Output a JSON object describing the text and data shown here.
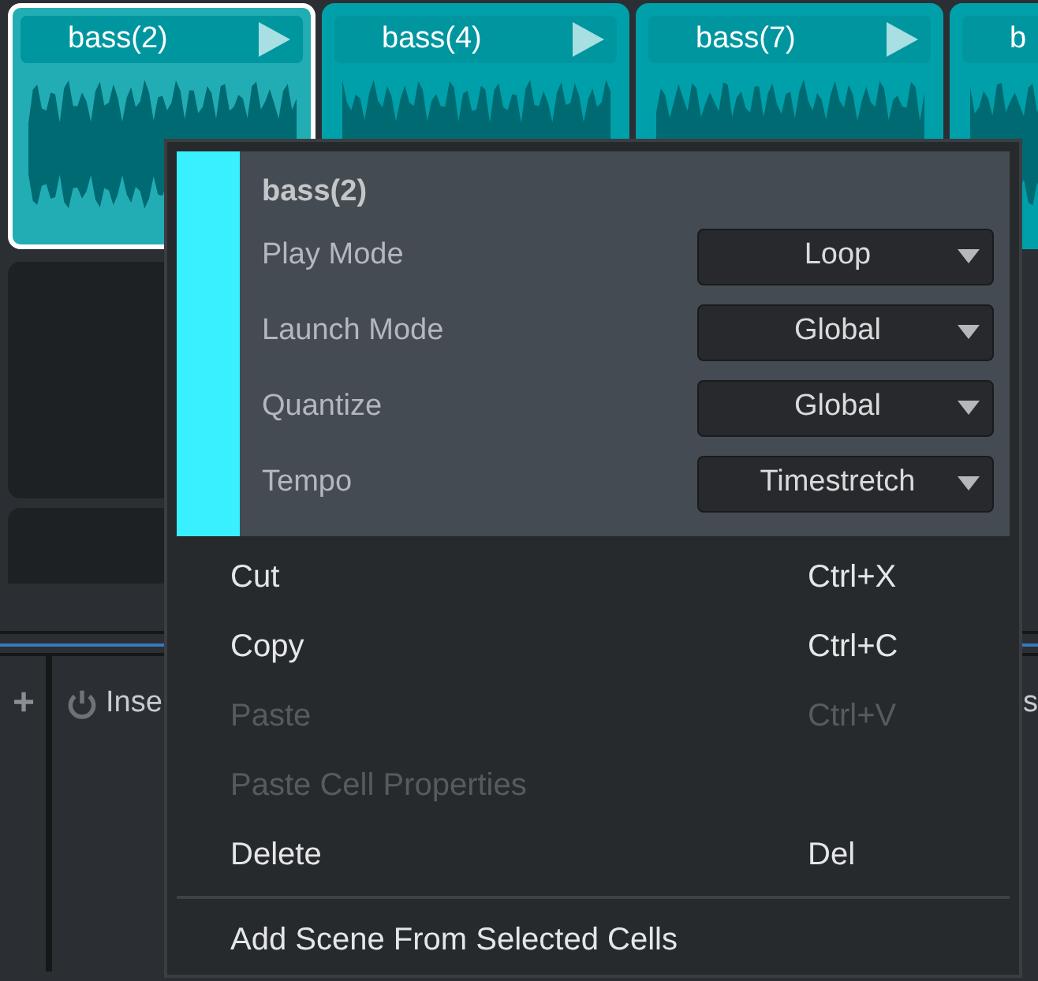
{
  "clips": [
    {
      "label": "bass(2)",
      "selected": true
    },
    {
      "label": "bass(4)",
      "selected": false
    },
    {
      "label": "bass(7)",
      "selected": false
    },
    {
      "label": "b",
      "selected": false
    }
  ],
  "mixer": {
    "add_icon": "+",
    "insert_label": "Inse",
    "right_label": "s"
  },
  "context_menu": {
    "header": {
      "title": "bass(2)",
      "color": "#38f0ff",
      "properties": [
        {
          "label": "Play Mode",
          "value": "Loop"
        },
        {
          "label": "Launch Mode",
          "value": "Global"
        },
        {
          "label": "Quantize",
          "value": "Global"
        },
        {
          "label": "Tempo",
          "value": "Timestretch"
        }
      ]
    },
    "items": [
      {
        "kind": "item",
        "label": "Cut",
        "shortcut": "Ctrl+X",
        "disabled": false
      },
      {
        "kind": "item",
        "label": "Copy",
        "shortcut": "Ctrl+C",
        "disabled": false
      },
      {
        "kind": "item",
        "label": "Paste",
        "shortcut": "Ctrl+V",
        "disabled": true
      },
      {
        "kind": "item",
        "label": "Paste Cell Properties",
        "disabled": true
      },
      {
        "kind": "item",
        "label": "Delete",
        "shortcut": "Del",
        "disabled": false
      },
      {
        "kind": "separator"
      },
      {
        "kind": "item",
        "label": "Add Scene From Selected Cells",
        "disabled": false
      }
    ]
  }
}
